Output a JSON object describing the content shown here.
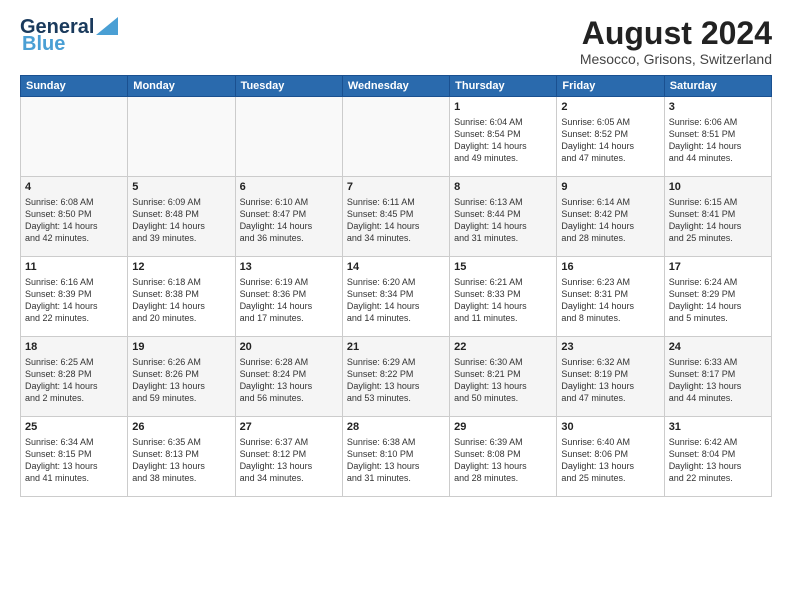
{
  "header": {
    "logo_line1": "General",
    "logo_line2": "Blue",
    "title": "August 2024",
    "subtitle": "Mesocco, Grisons, Switzerland"
  },
  "calendar": {
    "weekdays": [
      "Sunday",
      "Monday",
      "Tuesday",
      "Wednesday",
      "Thursday",
      "Friday",
      "Saturday"
    ],
    "weeks": [
      [
        {
          "day": "",
          "info": ""
        },
        {
          "day": "",
          "info": ""
        },
        {
          "day": "",
          "info": ""
        },
        {
          "day": "",
          "info": ""
        },
        {
          "day": "1",
          "info": "Sunrise: 6:04 AM\nSunset: 8:54 PM\nDaylight: 14 hours\nand 49 minutes."
        },
        {
          "day": "2",
          "info": "Sunrise: 6:05 AM\nSunset: 8:52 PM\nDaylight: 14 hours\nand 47 minutes."
        },
        {
          "day": "3",
          "info": "Sunrise: 6:06 AM\nSunset: 8:51 PM\nDaylight: 14 hours\nand 44 minutes."
        }
      ],
      [
        {
          "day": "4",
          "info": "Sunrise: 6:08 AM\nSunset: 8:50 PM\nDaylight: 14 hours\nand 42 minutes."
        },
        {
          "day": "5",
          "info": "Sunrise: 6:09 AM\nSunset: 8:48 PM\nDaylight: 14 hours\nand 39 minutes."
        },
        {
          "day": "6",
          "info": "Sunrise: 6:10 AM\nSunset: 8:47 PM\nDaylight: 14 hours\nand 36 minutes."
        },
        {
          "day": "7",
          "info": "Sunrise: 6:11 AM\nSunset: 8:45 PM\nDaylight: 14 hours\nand 34 minutes."
        },
        {
          "day": "8",
          "info": "Sunrise: 6:13 AM\nSunset: 8:44 PM\nDaylight: 14 hours\nand 31 minutes."
        },
        {
          "day": "9",
          "info": "Sunrise: 6:14 AM\nSunset: 8:42 PM\nDaylight: 14 hours\nand 28 minutes."
        },
        {
          "day": "10",
          "info": "Sunrise: 6:15 AM\nSunset: 8:41 PM\nDaylight: 14 hours\nand 25 minutes."
        }
      ],
      [
        {
          "day": "11",
          "info": "Sunrise: 6:16 AM\nSunset: 8:39 PM\nDaylight: 14 hours\nand 22 minutes."
        },
        {
          "day": "12",
          "info": "Sunrise: 6:18 AM\nSunset: 8:38 PM\nDaylight: 14 hours\nand 20 minutes."
        },
        {
          "day": "13",
          "info": "Sunrise: 6:19 AM\nSunset: 8:36 PM\nDaylight: 14 hours\nand 17 minutes."
        },
        {
          "day": "14",
          "info": "Sunrise: 6:20 AM\nSunset: 8:34 PM\nDaylight: 14 hours\nand 14 minutes."
        },
        {
          "day": "15",
          "info": "Sunrise: 6:21 AM\nSunset: 8:33 PM\nDaylight: 14 hours\nand 11 minutes."
        },
        {
          "day": "16",
          "info": "Sunrise: 6:23 AM\nSunset: 8:31 PM\nDaylight: 14 hours\nand 8 minutes."
        },
        {
          "day": "17",
          "info": "Sunrise: 6:24 AM\nSunset: 8:29 PM\nDaylight: 14 hours\nand 5 minutes."
        }
      ],
      [
        {
          "day": "18",
          "info": "Sunrise: 6:25 AM\nSunset: 8:28 PM\nDaylight: 14 hours\nand 2 minutes."
        },
        {
          "day": "19",
          "info": "Sunrise: 6:26 AM\nSunset: 8:26 PM\nDaylight: 13 hours\nand 59 minutes."
        },
        {
          "day": "20",
          "info": "Sunrise: 6:28 AM\nSunset: 8:24 PM\nDaylight: 13 hours\nand 56 minutes."
        },
        {
          "day": "21",
          "info": "Sunrise: 6:29 AM\nSunset: 8:22 PM\nDaylight: 13 hours\nand 53 minutes."
        },
        {
          "day": "22",
          "info": "Sunrise: 6:30 AM\nSunset: 8:21 PM\nDaylight: 13 hours\nand 50 minutes."
        },
        {
          "day": "23",
          "info": "Sunrise: 6:32 AM\nSunset: 8:19 PM\nDaylight: 13 hours\nand 47 minutes."
        },
        {
          "day": "24",
          "info": "Sunrise: 6:33 AM\nSunset: 8:17 PM\nDaylight: 13 hours\nand 44 minutes."
        }
      ],
      [
        {
          "day": "25",
          "info": "Sunrise: 6:34 AM\nSunset: 8:15 PM\nDaylight: 13 hours\nand 41 minutes."
        },
        {
          "day": "26",
          "info": "Sunrise: 6:35 AM\nSunset: 8:13 PM\nDaylight: 13 hours\nand 38 minutes."
        },
        {
          "day": "27",
          "info": "Sunrise: 6:37 AM\nSunset: 8:12 PM\nDaylight: 13 hours\nand 34 minutes."
        },
        {
          "day": "28",
          "info": "Sunrise: 6:38 AM\nSunset: 8:10 PM\nDaylight: 13 hours\nand 31 minutes."
        },
        {
          "day": "29",
          "info": "Sunrise: 6:39 AM\nSunset: 8:08 PM\nDaylight: 13 hours\nand 28 minutes."
        },
        {
          "day": "30",
          "info": "Sunrise: 6:40 AM\nSunset: 8:06 PM\nDaylight: 13 hours\nand 25 minutes."
        },
        {
          "day": "31",
          "info": "Sunrise: 6:42 AM\nSunset: 8:04 PM\nDaylight: 13 hours\nand 22 minutes."
        }
      ]
    ]
  }
}
